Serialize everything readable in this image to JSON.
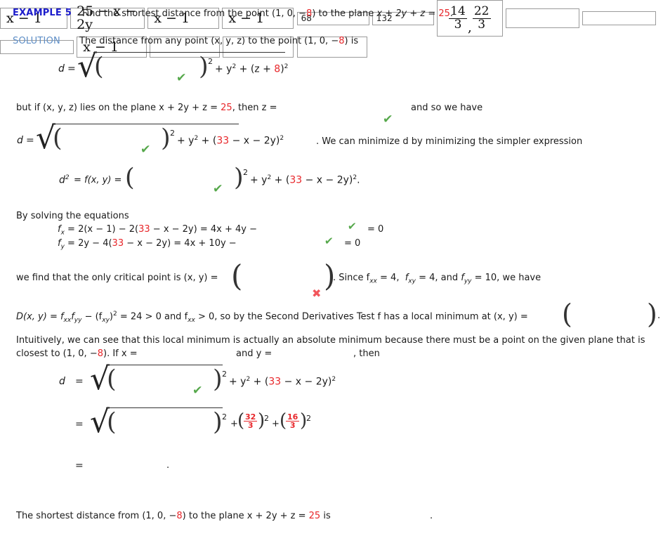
{
  "header": {
    "example_label": "EXAMPLE 5",
    "example_text_a": "Find the shortest distance from the point  (1, 0, −",
    "example_neg8": "8",
    "example_text_b": ")  to the plane  ",
    "plane_expr": "x + 2y + z = ",
    "plane_value": "25",
    "period": ".",
    "solution_label": "SOLUTION",
    "solution_text_a": "The distance from any point  (x, y, z)  to the point  (1, 0, −",
    "solution_text_b": ")  is"
  },
  "line_d1": {
    "d_label": "d",
    "equals": "=",
    "input_value": "x − 1",
    "status": "correct",
    "exp2": "2",
    "tail_a": "+ y",
    "tail_b": "+ (z + ",
    "tail_red": "8",
    "tail_c": ")"
  },
  "line_plane": {
    "text_a": "but if  (x, y, z)  lies on the plane  x + 2y + z = ",
    "red_25": "25",
    "text_b": ",  then  z = ",
    "input_value": "25 − x − 2y",
    "status": "correct",
    "text_c": "and so we have"
  },
  "line_d2": {
    "d_label": "d",
    "equals": "=",
    "input_value": "x − 1",
    "status": "correct",
    "exp2": "2",
    "tail_a": "+ y",
    "tail_b": "+ (",
    "tail_red": "33",
    "tail_c": " − x − 2y)",
    "tail_d": ".  We can minimize d by minimizing the simpler expression"
  },
  "line_dsq": {
    "lhs_d": "d",
    "lhs_sup": "2",
    "lhs_fn": "= f(x, y) =",
    "input_value": "x − 1",
    "status": "correct",
    "exp2": "2",
    "tail_a": "+ y",
    "tail_b": "+ (",
    "tail_red": "33",
    "tail_c": " − x − 2y)",
    "tail_end": "."
  },
  "solving": {
    "intro": "By solving the equations",
    "fx": {
      "name_f": "f",
      "name_sub": "x",
      "lhs": "=  2(x − 1) − 2(",
      "red": "33",
      "mid": " − x − 2y) = 4x + 4y −",
      "input_value": "68",
      "status": "correct",
      "rhs": "= 0"
    },
    "fy": {
      "name_f": "f",
      "name_sub": "y",
      "lhs": "=  2y − 4(",
      "red": "33",
      "mid": " − x − 2y) = 4x + 10y −",
      "input_value": "132",
      "status": "correct",
      "rhs": "= 0"
    }
  },
  "critical": {
    "text_a": "we find that the only critical point is  (x, y) =",
    "frac1_num": "14",
    "frac1_den": "3",
    "comma": ",",
    "frac2_num": "22",
    "frac2_den": "3",
    "status": "incorrect",
    "text_b": ".  Since  f",
    "fxx_sub": "xx",
    "fxx_val": " = 4,",
    "fxy_f": "f",
    "fxy_sub": "xy",
    "fxy_val": " = 4,  and",
    "fyy_f": "f",
    "fyy_sub": "yy",
    "fyy_val": " = 10,  we have"
  },
  "dtest": {
    "d_of": "D(x, y) = f",
    "s1": "xx",
    "f2": "f",
    "s2": "yy",
    "minus": " − (f",
    "s3": "xy",
    "close": ")",
    "sup2": "2",
    "eq24": " = 24 > 0  and  f",
    "s4": "xx",
    "gt0": " > 0,  so by the Second Derivatives Test f has a local minimum at  (x, y) =",
    "input_value": "",
    "period": "."
  },
  "intuitive": {
    "line1": "Intuitively, we can see that this local minimum is actually an absolute minimum because there must be a point on the given plane that is",
    "line2_a": "closest to  (1, 0, −",
    "line2_red": "8",
    "line2_b": ").  If  x =",
    "x_value": "",
    "line2_c": "and  y =",
    "y_value": "",
    "line2_d": ",  then"
  },
  "final_d1": {
    "d_label": "d",
    "equals": "=",
    "input_value": "x − 1",
    "status": "correct",
    "exp2": "2",
    "tail_a": "+ y",
    "tail_b": "+ (",
    "tail_red": "33",
    "tail_c": " − x − 2y)"
  },
  "final_d2": {
    "equals": "=",
    "input_value": "",
    "exp2": "2",
    "plus1": "+",
    "f1_num": "32",
    "f1_den": "3",
    "f1_sup": "2",
    "plus2": "+",
    "f2_num": "16",
    "f2_den": "3",
    "f2_sup": "2"
  },
  "final_d3": {
    "equals": "=",
    "input_value": "",
    "period": "."
  },
  "conclusion": {
    "text_a": "The shortest distance from  (1, 0, −",
    "red8": "8",
    "text_b": ")  to the plane  x + 2y + z = ",
    "red25": "25",
    "text_c": "is",
    "input_value": "",
    "period": "."
  },
  "colors": {
    "example_blue": "#1c1ccc",
    "solution_blue": "#5f8fc7",
    "red": "#e8262a",
    "check_green": "#56a84b",
    "x_red": "#f2565c",
    "box_border": "#9b9b9b"
  },
  "icons": {
    "check": "✔",
    "cross": "✖"
  }
}
